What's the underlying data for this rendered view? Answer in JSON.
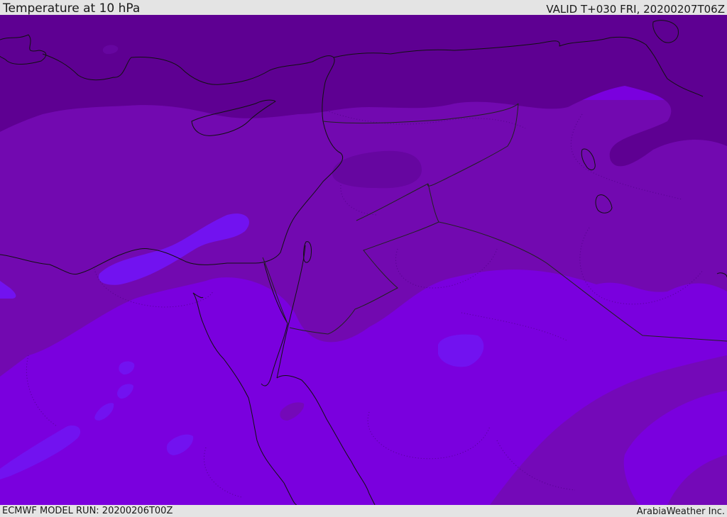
{
  "header": {
    "title": "Temperature at 10 hPa",
    "valid_time": "VALID T+030 FRI, 20200207T06Z"
  },
  "footer": {
    "model_run": "ECMWF MODEL RUN: 20200206T00Z",
    "credit": "ArabiaWeather Inc."
  },
  "map": {
    "variable": "Temperature",
    "level": "10 hPa",
    "colors": {
      "coldest": "#5e0092",
      "cold": "#7209b0",
      "medium": "#7b00d6",
      "warm": "#7a00de",
      "warmest": "#7212f0",
      "coastline": "#111111",
      "border": "#222222"
    }
  }
}
